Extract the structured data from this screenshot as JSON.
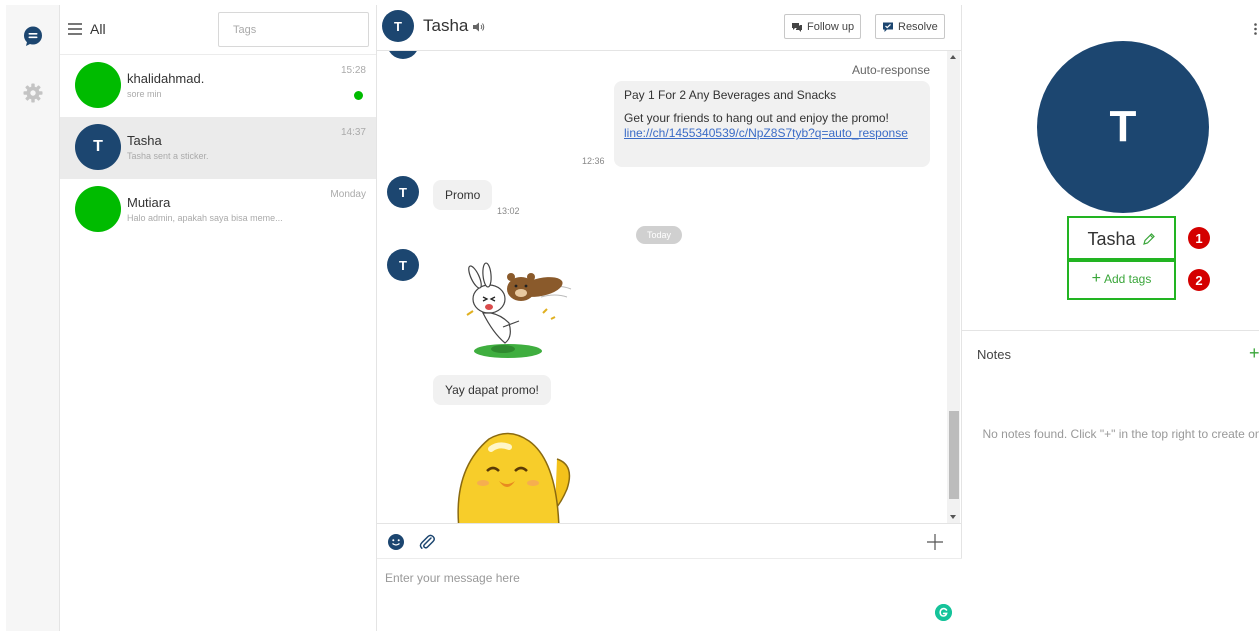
{
  "rail": {
    "icons": [
      "chat-icon",
      "settings-icon"
    ]
  },
  "list": {
    "filter_label": "All",
    "tags_placeholder": "Tags",
    "chats": [
      {
        "name": "khalidahmad.",
        "preview": "sore min",
        "time": "15:28",
        "unread": true,
        "avatar_color": "#00bb00"
      },
      {
        "name": "Tasha",
        "preview": "Tasha sent a sticker.",
        "time": "14:37",
        "initial": "T",
        "active": true,
        "avatar_color": "#1c4670"
      },
      {
        "name": "Mutiara",
        "preview": "Halo admin, apakah saya bisa meme...",
        "time": "Monday",
        "avatar_color": "#00bb00"
      }
    ]
  },
  "conversation": {
    "contact_name": "Tasha",
    "contact_initial": "T",
    "follow_up_label": "Follow up",
    "resolve_label": "Resolve",
    "auto_response_label": "Auto-response",
    "outgoing": {
      "line1": "Pay 1 For 2 Any Beverages and Snacks",
      "line2": "Get your friends to hang out and enjoy the promo!",
      "link": "line://ch/1455340539/c/NpZ8S7tyb?q=auto_response",
      "time": "12:36"
    },
    "incoming_1": {
      "text": "Promo",
      "time": "13:02"
    },
    "date_separator": "Today",
    "incoming_2": {
      "text": "Yay dapat promo!"
    },
    "message_placeholder": "Enter your message here"
  },
  "profile": {
    "initial": "T",
    "name": "Tasha",
    "add_tags_label": "Add tags",
    "plus": "+",
    "badge_1": "1",
    "badge_2": "2",
    "notes_title": "Notes",
    "notes_add": "+",
    "notes_empty": "No notes found. Click \"+\" in the top right to create one."
  },
  "colors": {
    "navy": "#1c4670",
    "green": "#00bb00",
    "highlight_border": "#22b422",
    "badge_red": "#d40000",
    "link": "#3b6cc7"
  }
}
